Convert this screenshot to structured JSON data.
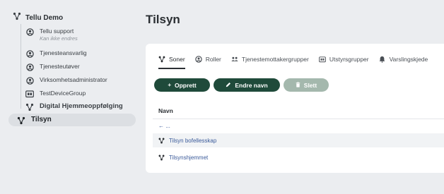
{
  "sidebar": {
    "root": {
      "label": "Tellu Demo",
      "icon": "network-icon"
    },
    "items": [
      {
        "label": "Tellu support",
        "sublabel": "Kan ikke endres",
        "icon": "user-circle-icon"
      },
      {
        "label": "Tjenesteansvarlig",
        "icon": "user-circle-icon"
      },
      {
        "label": "Tjenesteutøver",
        "icon": "user-circle-icon"
      },
      {
        "label": "Virksomhetsadministrator",
        "icon": "user-circle-icon"
      },
      {
        "label": "TestDeviceGroup",
        "icon": "device-group-icon"
      },
      {
        "label": "Digital Hjemmeoppfølging",
        "icon": "network-icon"
      },
      {
        "label": "Tilsyn",
        "icon": "network-icon"
      }
    ]
  },
  "page": {
    "title": "Tilsyn"
  },
  "tabs": [
    {
      "label": "Soner",
      "icon": "network-icon"
    },
    {
      "label": "Roller",
      "icon": "user-circle-icon"
    },
    {
      "label": "Tjenestemottakergrupper",
      "icon": "group-icon"
    },
    {
      "label": "Utstyrsgrupper",
      "icon": "device-group-icon"
    },
    {
      "label": "Varslingskjede",
      "icon": "bell-icon"
    }
  ],
  "buttons": {
    "create": {
      "label": "Opprett",
      "icon": "+"
    },
    "rename": {
      "label": "Endre navn",
      "icon": "pencil-icon"
    },
    "delete": {
      "label": "Slett",
      "icon": "trash-icon"
    }
  },
  "table": {
    "header": "Navn",
    "back_row": "← ...",
    "rows": [
      {
        "label": "Tilsyn bofellesskap",
        "icon": "network-icon"
      },
      {
        "label": "Tilsynshjemmet",
        "icon": "network-icon"
      }
    ]
  },
  "colors": {
    "primary_button": "#1f4a3a",
    "disabled_button": "#a4b8ad",
    "link": "#3a5a9a",
    "background": "#ebedf0"
  }
}
